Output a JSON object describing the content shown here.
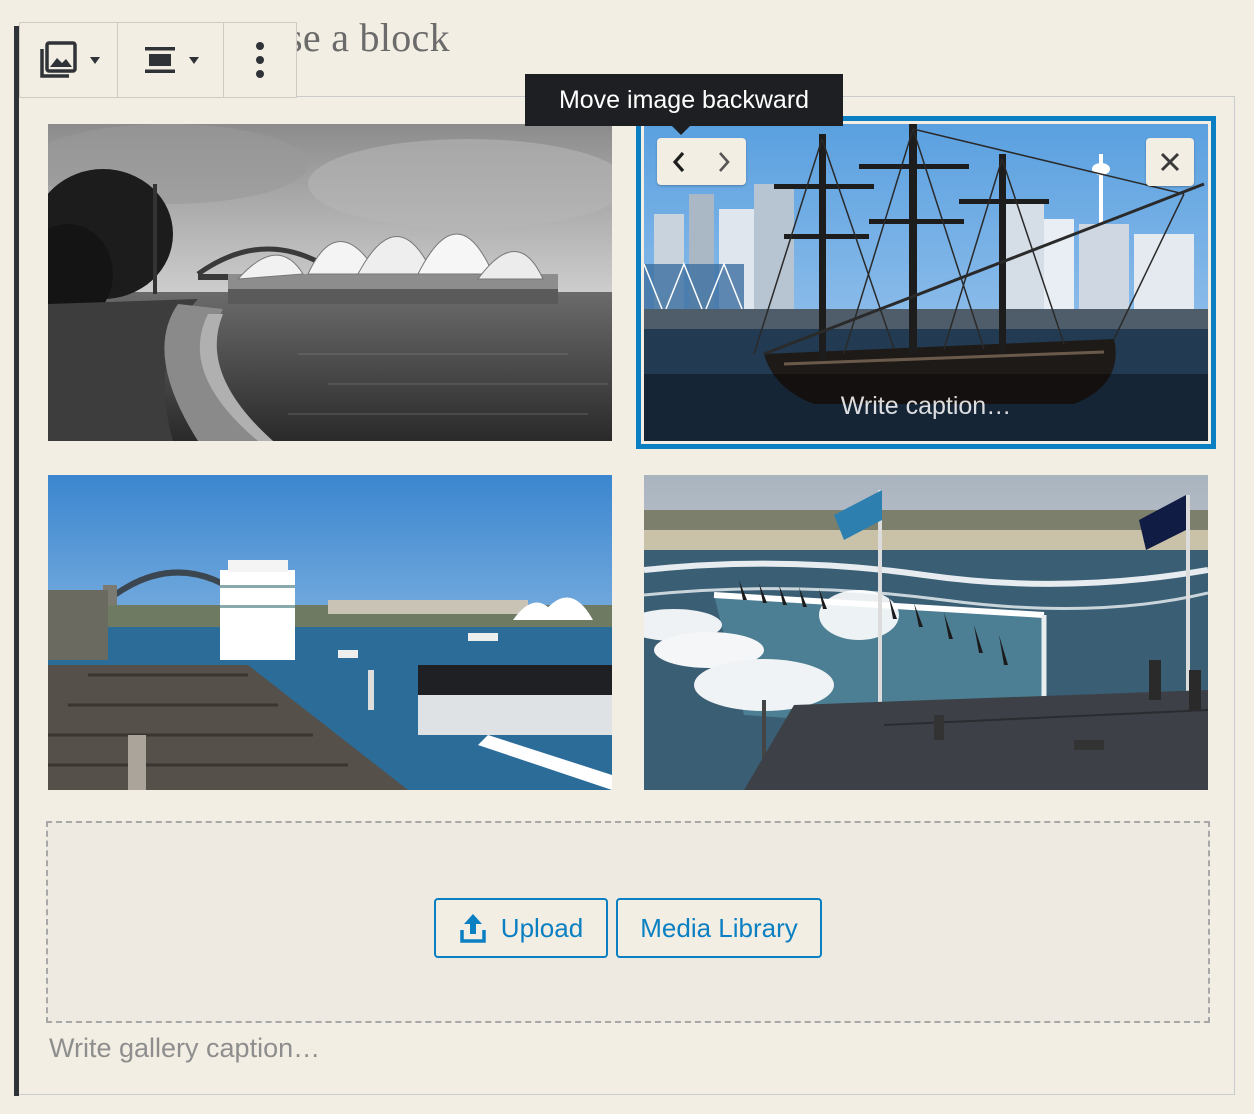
{
  "editor": {
    "placeholder_text": "r type / to choose a block"
  },
  "toolbar": {
    "block_type_icon": "gallery-icon",
    "align_icon": "align-center-icon",
    "more_icon": "more-vertical-icon"
  },
  "tooltip": {
    "text": "Move image backward"
  },
  "gallery": {
    "images": [
      {
        "subject": "Sydney Opera House",
        "selected": false
      },
      {
        "subject": "Tall ship at Darling Harbour",
        "selected": true,
        "caption_placeholder": "Write caption…"
      },
      {
        "subject": "Circular Quay with cruise ship",
        "selected": false
      },
      {
        "subject": "Bondi Icebergs pool",
        "selected": false
      }
    ],
    "upload_label": "Upload",
    "media_library_label": "Media Library",
    "caption_placeholder": "Write gallery caption…"
  },
  "colors": {
    "accent": "#0a7fc2",
    "background": "#f3eee3",
    "tooltip_bg": "#1e1f22"
  }
}
